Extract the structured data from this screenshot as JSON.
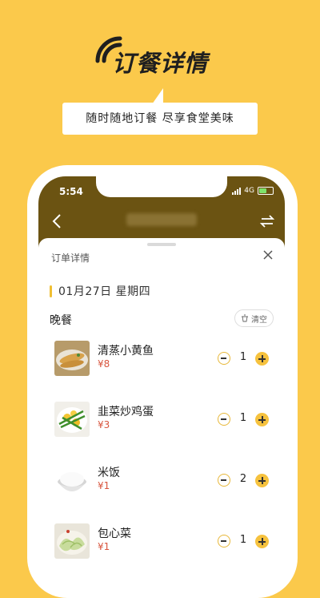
{
  "promo": {
    "title": "订餐详情",
    "tagline": "随时随地订餐   尽享食堂美味"
  },
  "status_bar": {
    "time": "5:54",
    "network": "4G"
  },
  "sheet": {
    "title": "订单详情",
    "date": "01月27日 星期四",
    "meal": "晚餐",
    "clear_label": "清空"
  },
  "items": [
    {
      "name": "清蒸小黄鱼",
      "price": "¥8",
      "qty": "1"
    },
    {
      "name": "韭菜炒鸡蛋",
      "price": "¥3",
      "qty": "1"
    },
    {
      "name": "米饭",
      "price": "¥1",
      "qty": "2"
    },
    {
      "name": "包心菜",
      "price": "¥1",
      "qty": "1"
    }
  ],
  "colors": {
    "background": "#fbc94b",
    "nav": "#6b5312",
    "accent": "#f6c23e",
    "price": "#d8553e"
  }
}
